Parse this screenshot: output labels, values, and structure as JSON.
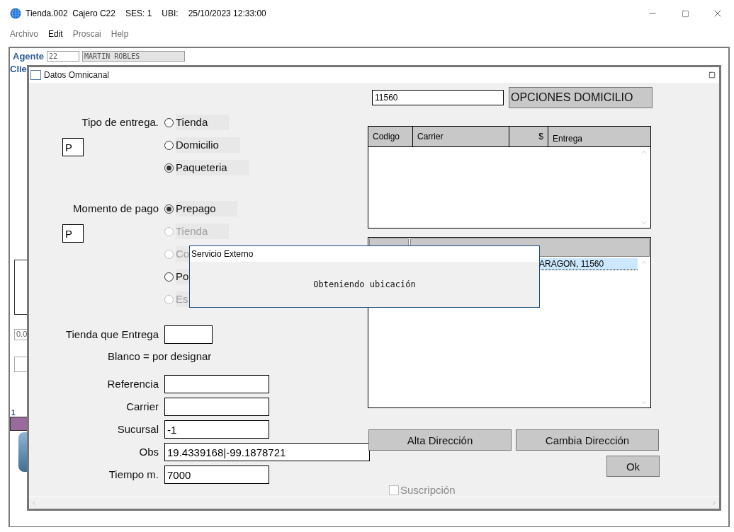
{
  "window": {
    "title": "Tienda.002  Cajero C22",
    "session": "SES: 1",
    "location_label": "UBI:",
    "datetime": "25/10/2023 12:33:00"
  },
  "menu": [
    {
      "label": "Archivo",
      "disabled": true
    },
    {
      "label": "Edit",
      "disabled": false
    },
    {
      "label": "Proscai",
      "disabled": true
    },
    {
      "label": "Help",
      "disabled": true
    }
  ],
  "agent": {
    "label": "Agente",
    "code": "22",
    "name": "MARTIN ROBLES"
  },
  "background": {
    "client_label": "Clie",
    "amount": "0.0",
    "counter": "1"
  },
  "dialog": {
    "title": "Datos Omnicanal",
    "delivery_type": {
      "label": "Tipo de entrega.",
      "code": "P",
      "options": [
        {
          "label": "Tienda",
          "selected": false,
          "disabled": false
        },
        {
          "label": "Domicilio",
          "selected": false,
          "disabled": false
        },
        {
          "label": "Paqueteria",
          "selected": true,
          "disabled": false
        }
      ]
    },
    "payment_moment": {
      "label": "Momento de pago",
      "code": "P",
      "options": [
        {
          "label": "Prepago",
          "selected": true,
          "disabled": false
        },
        {
          "label": "Tienda",
          "selected": false,
          "disabled": true
        },
        {
          "label": "Co",
          "selected": false,
          "disabled": true
        },
        {
          "label": "Po",
          "selected": false,
          "disabled": false
        },
        {
          "label": "Es",
          "selected": false,
          "disabled": true
        }
      ]
    },
    "store": {
      "label": "Tienda que Entrega",
      "note": "Blanco = por designar"
    },
    "fields": [
      {
        "label": "Referencia",
        "kind": "short"
      },
      {
        "label": "Carrier",
        "kind": "short"
      },
      {
        "label": "Sucursal",
        "value": "-1",
        "kind": "short"
      },
      {
        "label": "Obs",
        "value": "19.4339168|-99.1878721",
        "kind": "wide"
      },
      {
        "label": "Tiempo m.",
        "value": "7000",
        "kind": "short"
      }
    ],
    "zip_code": "11560",
    "options_button": "OPCIONES DOMICILIO",
    "carriers_table": {
      "columns": [
        "Codigo",
        "Carrier",
        "$",
        "Entrega"
      ]
    },
    "address_table": {
      "rows": [
        {
          "text": "ARAGON, 11560",
          "selected": true
        }
      ]
    },
    "buttons": [
      "Alta Dirección",
      "Cambia Dirección"
    ],
    "ok_button": "Ok",
    "subscription": {
      "label": "Suscripción",
      "checked": false,
      "disabled": true
    }
  },
  "popup": {
    "title": "Servicio Externo",
    "message": "Obteniendo ubicación"
  }
}
